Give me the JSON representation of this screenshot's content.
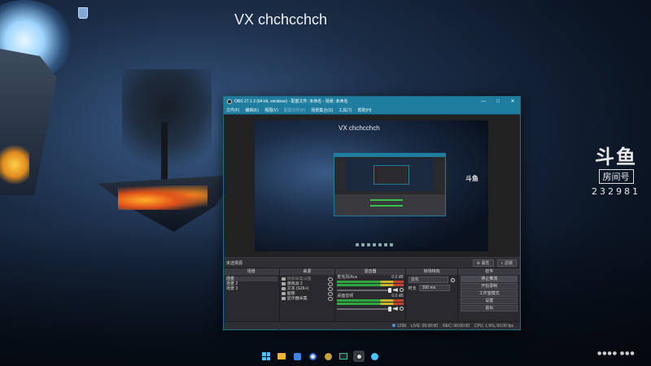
{
  "desktop": {
    "overlay_title": "VX chchcchch",
    "watermark": {
      "logo": "斗鱼",
      "room_label": "房间号",
      "room_number": "232981"
    },
    "tray_text": "●●●● ●●●"
  },
  "obs": {
    "window_title": "OBS 27.1.3 (64-bit, windows) - 配置文件: 未命名 - 场景: 未命名",
    "window_buttons": [
      "—",
      "□",
      "✕"
    ],
    "menu": [
      "文件(F)",
      "编辑(E)",
      "视图(V)",
      "配置文件(P)",
      "场景集合(S)",
      "工具(T)",
      "帮助(H)"
    ],
    "preview": {
      "title": "VX chchcchch",
      "nested_logo": "斗鱼"
    },
    "source_toolbar": {
      "status": "未选择源",
      "properties": "属性",
      "filters": "滤镜"
    },
    "scenes": {
      "header": "场景",
      "items": [
        "场景",
        "场景 2",
        "场景 3"
      ]
    },
    "sources": {
      "header": "来源",
      "items": [
        {
          "name": "视频采集设备",
          "dim": true
        },
        {
          "name": "游戏源 2",
          "dim": false
        },
        {
          "name": "文本 (GDI+)",
          "dim": false
        },
        {
          "name": "图像",
          "dim": false
        },
        {
          "name": "显示器采集",
          "dim": false
        }
      ]
    },
    "mixer": {
      "header": "混音器",
      "channels": [
        {
          "name": "麦克风/Aux",
          "level": "0.0 dB"
        },
        {
          "name": "桌面音频",
          "level": "0.0 dB"
        }
      ]
    },
    "transitions": {
      "header": "转场特效",
      "type": "淡化",
      "duration_label": "时长",
      "duration": "300 ms"
    },
    "controls": {
      "header": "控件",
      "buttons": [
        "停止推流",
        "开始录制",
        "工作室模式",
        "设置",
        "退出"
      ]
    },
    "statusbar": {
      "live": "LIVE: 00:00:00",
      "rec": "REC: 00:00:00",
      "cpu": "CPU: 1.9%, 60.00 fps",
      "dropped": "1298"
    }
  },
  "taskbar": {
    "icons": [
      "windows-start-icon",
      "file-explorer-icon",
      "app-icon",
      "browser-icon",
      "game-icon",
      "terminal-icon",
      "obs-icon",
      "chat-icon"
    ]
  }
}
